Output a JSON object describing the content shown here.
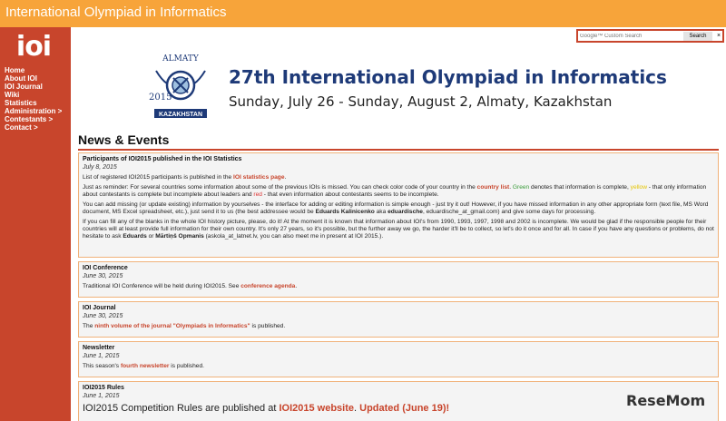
{
  "topbar": {
    "title": "International Olympiad in Informatics"
  },
  "logo": {
    "text": "ioi"
  },
  "nav": [
    "Home",
    "About IOI",
    "IOI Journal",
    "Wiki",
    "Statistics",
    "Administration >",
    "Contestants >",
    "Contact >"
  ],
  "search": {
    "placeholder": "Google™ Custom Search",
    "button": "Search",
    "close": "×"
  },
  "event": {
    "emblem_top": "ALMATY",
    "emblem_year": "2015",
    "emblem_bottom": "KAZAKHSTAN",
    "title": "27th International Olympiad in Informatics",
    "subtitle": "Sunday, July 26 - Sunday, August 2, Almaty, Kazakhstan"
  },
  "news_heading": "News & Events",
  "items": [
    {
      "title": "Participants of IOI2015 published in the IOI Statistics",
      "date": "July 8, 2015",
      "p1a": "List of registered IOI2015 participants is published in the ",
      "p1link": "IOI statistics page",
      "p1b": ".",
      "p2a": "Just as reminder: For several countries some information about some of the previous IOIs is missed. You can check color code of your country in the ",
      "p2link": "country list",
      "p2b": ". ",
      "green": "Green",
      "p2c": " denotes that information is complete, ",
      "yellow": "yellow",
      "p2d": " - that only information about contestants is complete but incomplete about leaders and ",
      "red": "red",
      "p2e": " - that even information about contestants seems to be incomplete.",
      "p3a": "You can add missing (or update existing) information by yourselves - the interface for adding or editing information is simple enough - just try it out! However, if you have missed information in any other appropriate form (text file, MS Word document, MS Excel spreadsheet, etc.), just send it to us (the best addressee would be ",
      "p3name": "Eduards Kalinicenko",
      "p3b": " aka ",
      "p3nick": "eduardische",
      "p3c": ", eduardische_at_gmail.com) and give some days for processing.",
      "p4a": "If you can fill any of the blanks in the whole IOI history picture, please, do it! At the moment it is known that information about IOI's from 1990, 1993, 1997, 1998 and 2002 is incomplete. We would be glad if the responsible people for their countries will at least provide full information for their own country. It's only 27 years, so it's possible, but the further away we go, the harder it'll be to collect, so let's do it once and for all. In case if you have any questions or problems, do not hesitate to ask ",
      "p4n1": "Eduards",
      "p4b": " or ",
      "p4n2": "Mārtiņš Opmanis",
      "p4c": " (askola_at_latnet.lv, you can also meet me in present at IOI 2015.)."
    },
    {
      "title": "IOI Conference",
      "date": "June 30, 2015",
      "ta": "Traditional IOI Conference will be held during IOI2015. See ",
      "link": "conference agenda",
      "tb": "."
    },
    {
      "title": "IOI Journal",
      "date": "June 30, 2015",
      "ta": "The ",
      "link": "ninth volume of the journal \"Olympiads in Informatics\"",
      "tb": " is published."
    },
    {
      "title": "Newsletter",
      "date": "June 1, 2015",
      "ta": "This season's ",
      "link": "fourth newsletter",
      "tb": " is published."
    },
    {
      "title": "IOI2015 Rules",
      "date": "June 1, 2015",
      "ta": "IOI2015 Competition Rules are published at ",
      "link": "IOI2015 website",
      "tb": ". ",
      "link2": "Updated (June 19)!"
    }
  ],
  "watermark": "ReseMom"
}
